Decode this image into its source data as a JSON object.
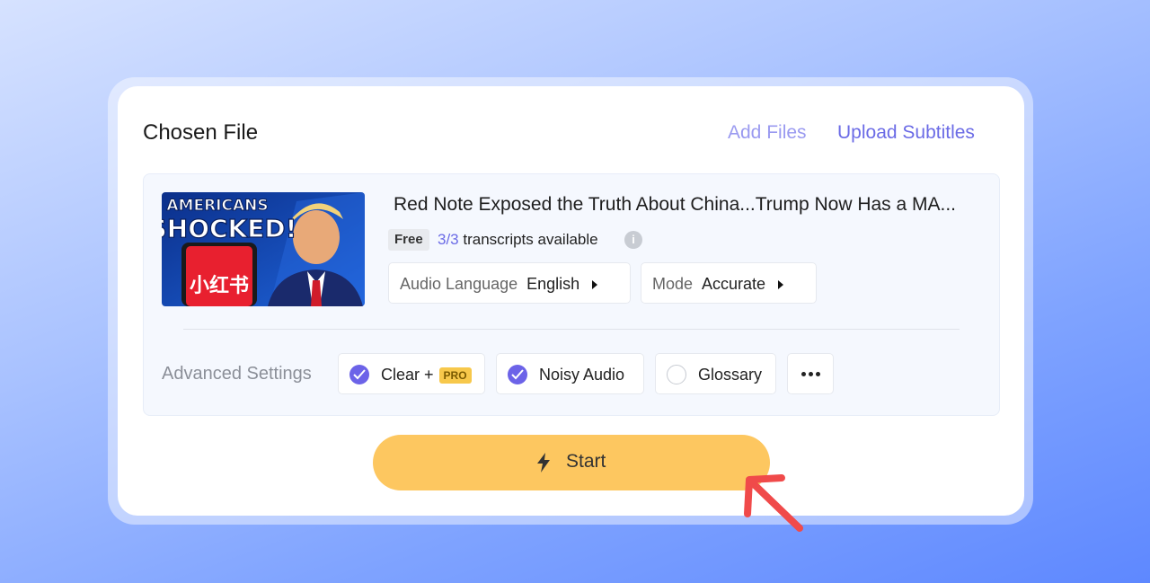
{
  "header": {
    "title": "Chosen File",
    "add_files": "Add Files",
    "upload_subtitles": "Upload Subtitles"
  },
  "file": {
    "thumbnail_line1": "AMERICANS",
    "thumbnail_line2": "SHOCKED!",
    "thumbnail_app": "小红书",
    "name": "Red Note Exposed the Truth About China...Trump Now Has a MA...",
    "badge": "Free",
    "transcripts_count": "3/3",
    "transcripts_text": "transcripts available",
    "audio_language_label": "Audio Language",
    "audio_language_value": "English",
    "mode_label": "Mode",
    "mode_value": "Accurate"
  },
  "advanced": {
    "label": "Advanced Settings",
    "options": [
      {
        "label": "Clear +",
        "badge": "PRO",
        "checked": true
      },
      {
        "label": "Noisy Audio",
        "checked": true
      },
      {
        "label": "Glossary",
        "checked": false
      }
    ]
  },
  "start_button": {
    "label": "Start"
  },
  "colors": {
    "accent": "#6b6be6",
    "start": "#fdc760",
    "arrow": "#f04a4a"
  }
}
